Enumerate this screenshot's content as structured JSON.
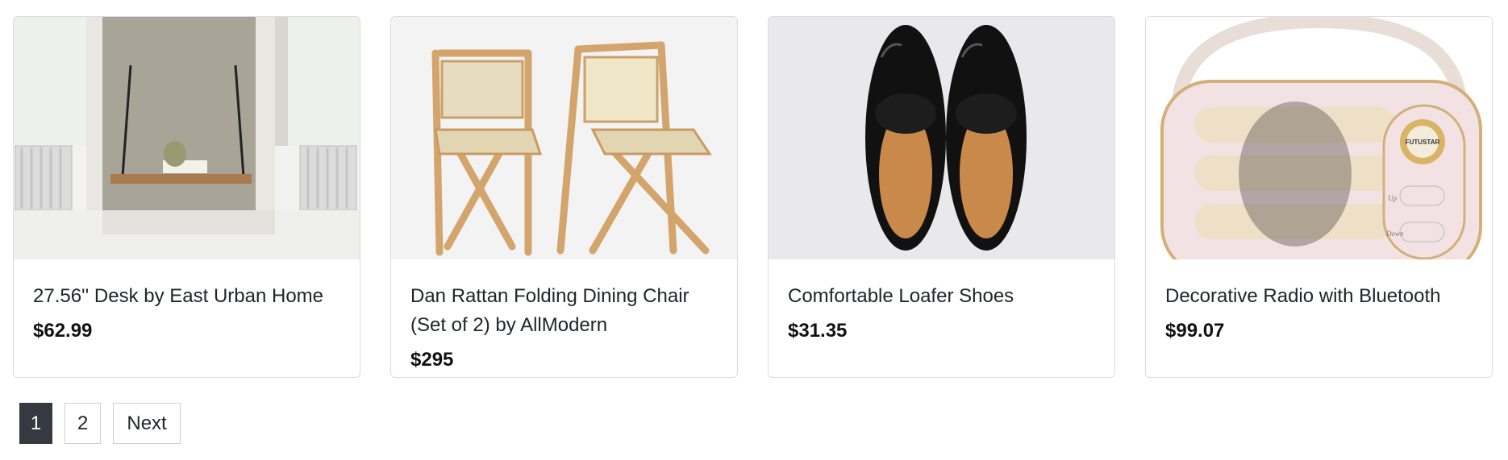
{
  "products": [
    {
      "title": "27.56'' Desk by East Urban Home",
      "price": "$62.99",
      "image_icon": "wall-desk-image"
    },
    {
      "title": "Dan Rattan Folding Dining Chair (Set of 2) by AllModern",
      "price": "$295",
      "image_icon": "rattan-chairs-image"
    },
    {
      "title": "Comfortable Loafer Shoes",
      "price": "$31.35",
      "image_icon": "loafer-shoes-image"
    },
    {
      "title": "Decorative Radio with Bluetooth",
      "price": "$99.07",
      "image_icon": "pink-radio-image"
    }
  ],
  "radio_brand": "FUTUSTAR",
  "radio_buttons": {
    "up": "Up",
    "down": "Down"
  },
  "pagination": {
    "pages": [
      "1",
      "2"
    ],
    "current": "1",
    "next_label": "Next"
  }
}
